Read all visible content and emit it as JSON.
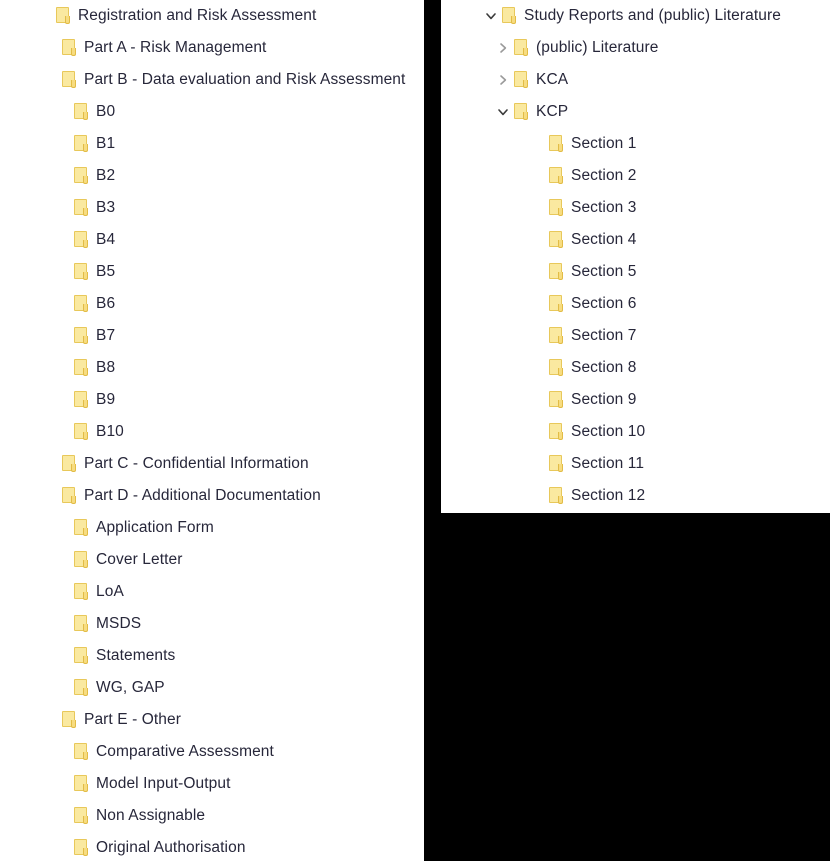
{
  "window": {
    "background_color": "#000000",
    "panel_color": "#ffffff",
    "text_color": "#27273a",
    "folder_color": "#fae9a0",
    "folder_border_color": "#e8c85a",
    "chevron_color": "#9a9a9a"
  },
  "left_panel": {
    "name": "document-tree-left",
    "rows": [
      {
        "label": "Registration and Risk Assessment",
        "level": 0,
        "icon": "folder-icon",
        "twisty": "none"
      },
      {
        "label": "Part A - Risk Management",
        "level": 1,
        "icon": "folder-icon",
        "twisty": "none"
      },
      {
        "label": "Part B - Data evaluation and Risk Assessment",
        "level": 1,
        "icon": "folder-icon",
        "twisty": "none"
      },
      {
        "label": "B0",
        "level": 2,
        "icon": "folder-icon",
        "twisty": "none"
      },
      {
        "label": "B1",
        "level": 2,
        "icon": "folder-icon",
        "twisty": "none"
      },
      {
        "label": "B2",
        "level": 2,
        "icon": "folder-icon",
        "twisty": "none"
      },
      {
        "label": "B3",
        "level": 2,
        "icon": "folder-icon",
        "twisty": "none"
      },
      {
        "label": "B4",
        "level": 2,
        "icon": "folder-icon",
        "twisty": "none"
      },
      {
        "label": "B5",
        "level": 2,
        "icon": "folder-icon",
        "twisty": "none"
      },
      {
        "label": "B6",
        "level": 2,
        "icon": "folder-icon",
        "twisty": "none"
      },
      {
        "label": "B7",
        "level": 2,
        "icon": "folder-icon",
        "twisty": "none"
      },
      {
        "label": "B8",
        "level": 2,
        "icon": "folder-icon",
        "twisty": "none"
      },
      {
        "label": "B9",
        "level": 2,
        "icon": "folder-icon",
        "twisty": "none"
      },
      {
        "label": "B10",
        "level": 2,
        "icon": "folder-icon",
        "twisty": "none"
      },
      {
        "label": "Part C - Confidential Information",
        "level": 1,
        "icon": "folder-icon",
        "twisty": "none"
      },
      {
        "label": "Part D - Additional Documentation",
        "level": 1,
        "icon": "folder-icon",
        "twisty": "none"
      },
      {
        "label": "Application Form",
        "level": 2,
        "icon": "folder-icon",
        "twisty": "none"
      },
      {
        "label": "Cover Letter",
        "level": 2,
        "icon": "folder-icon",
        "twisty": "none"
      },
      {
        "label": "LoA",
        "level": 2,
        "icon": "folder-icon",
        "twisty": "none"
      },
      {
        "label": "MSDS",
        "level": 2,
        "icon": "folder-icon",
        "twisty": "none"
      },
      {
        "label": "Statements",
        "level": 2,
        "icon": "folder-icon",
        "twisty": "none"
      },
      {
        "label": "WG, GAP",
        "level": 2,
        "icon": "folder-icon",
        "twisty": "none"
      },
      {
        "label": "Part E - Other",
        "level": 1,
        "icon": "folder-icon",
        "twisty": "none"
      },
      {
        "label": "Comparative Assessment",
        "level": 2,
        "icon": "folder-icon",
        "twisty": "none"
      },
      {
        "label": "Model Input-Output",
        "level": 2,
        "icon": "folder-icon",
        "twisty": "none"
      },
      {
        "label": "Non Assignable",
        "level": 2,
        "icon": "folder-icon",
        "twisty": "none"
      },
      {
        "label": "Original Authorisation",
        "level": 2,
        "icon": "folder-icon",
        "twisty": "none"
      }
    ]
  },
  "right_panel": {
    "name": "document-tree-right",
    "rows": [
      {
        "label": "Study Reports and (public) Literature",
        "level": 0,
        "icon": "folder-icon",
        "twisty": "expanded"
      },
      {
        "label": "(public) Literature",
        "level": 1,
        "icon": "folder-icon",
        "twisty": "collapsed"
      },
      {
        "label": "KCA",
        "level": 1,
        "icon": "folder-icon",
        "twisty": "collapsed"
      },
      {
        "label": "KCP",
        "level": 1,
        "icon": "folder-icon",
        "twisty": "expanded"
      },
      {
        "label": "Section 1",
        "level": 2,
        "icon": "folder-icon",
        "twisty": "none"
      },
      {
        "label": "Section 2",
        "level": 2,
        "icon": "folder-icon",
        "twisty": "none"
      },
      {
        "label": "Section 3",
        "level": 2,
        "icon": "folder-icon",
        "twisty": "none"
      },
      {
        "label": "Section 4",
        "level": 2,
        "icon": "folder-icon",
        "twisty": "none"
      },
      {
        "label": "Section 5",
        "level": 2,
        "icon": "folder-icon",
        "twisty": "none"
      },
      {
        "label": "Section 6",
        "level": 2,
        "icon": "folder-icon",
        "twisty": "none"
      },
      {
        "label": "Section 7",
        "level": 2,
        "icon": "folder-icon",
        "twisty": "none"
      },
      {
        "label": "Section 8",
        "level": 2,
        "icon": "folder-icon",
        "twisty": "none"
      },
      {
        "label": "Section 9",
        "level": 2,
        "icon": "folder-icon",
        "twisty": "none"
      },
      {
        "label": "Section 10",
        "level": 2,
        "icon": "folder-icon",
        "twisty": "none"
      },
      {
        "label": "Section 11",
        "level": 2,
        "icon": "folder-icon",
        "twisty": "none"
      },
      {
        "label": "Section 12",
        "level": 2,
        "icon": "folder-icon",
        "twisty": "none"
      }
    ]
  }
}
